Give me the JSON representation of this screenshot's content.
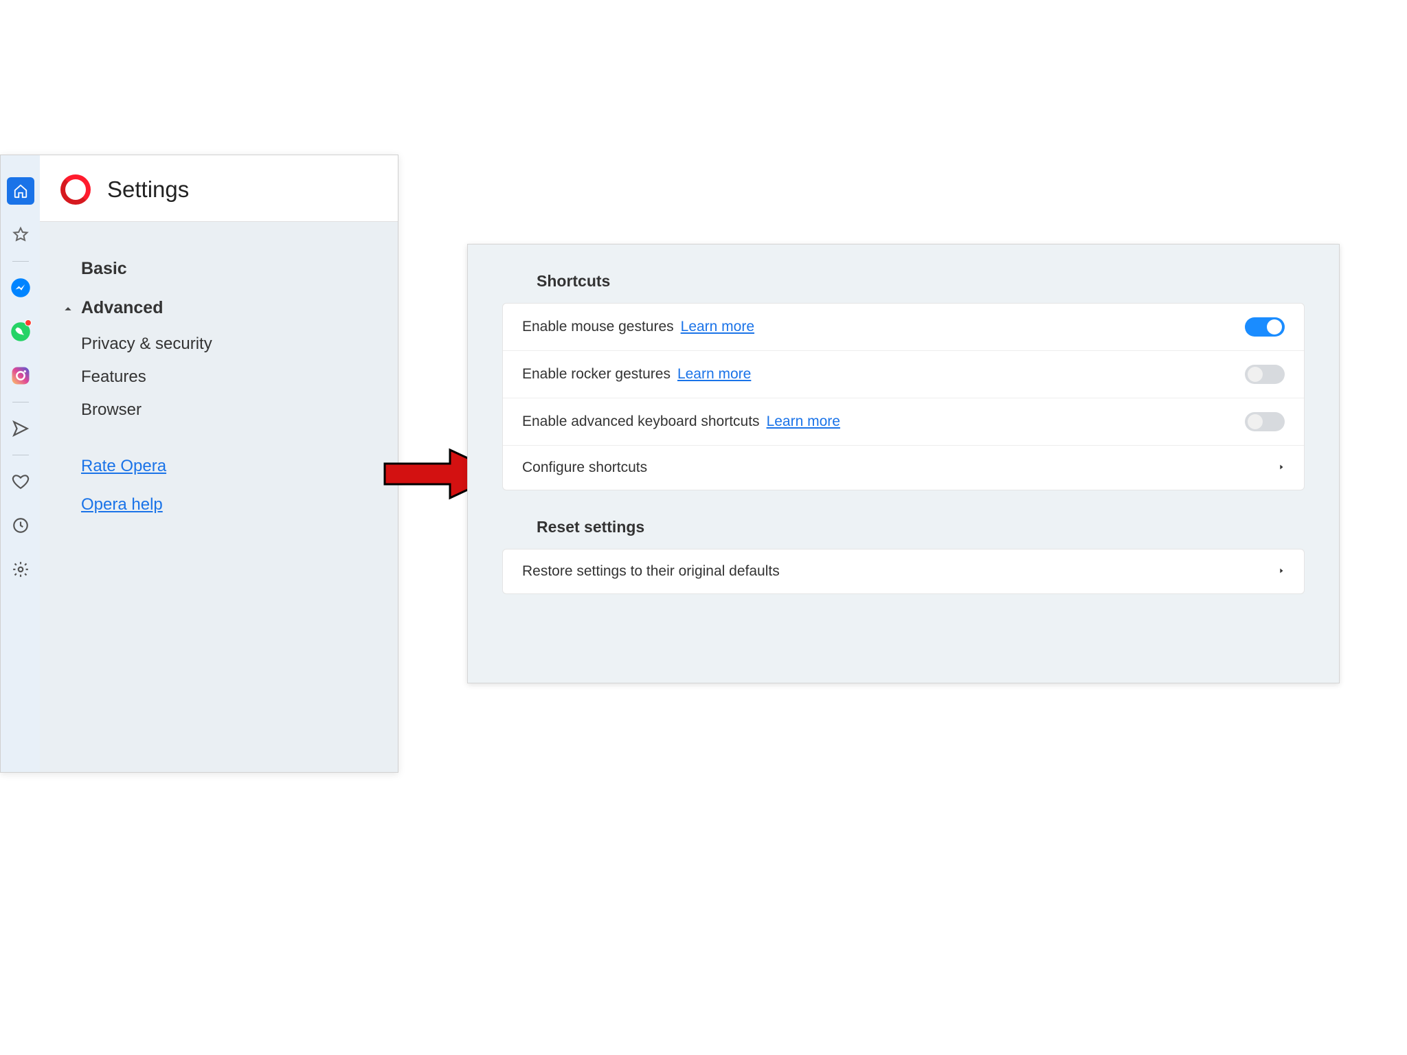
{
  "settings": {
    "title": "Settings",
    "nav": {
      "basic": "Basic",
      "advanced": "Advanced",
      "privacy": "Privacy & security",
      "features": "Features",
      "browser": "Browser",
      "rate": "Rate Opera",
      "help": "Opera help"
    }
  },
  "panel": {
    "shortcuts_title": "Shortcuts",
    "mouse_gestures": "Enable mouse gestures",
    "rocker_gestures": "Enable rocker gestures",
    "keyboard_shortcuts": "Enable advanced keyboard shortcuts",
    "learn_more": "Learn more",
    "configure": "Configure shortcuts",
    "reset_title": "Reset settings",
    "restore": "Restore settings to their original defaults",
    "toggles": {
      "mouse_gestures": true,
      "rocker_gestures": false,
      "keyboard_shortcuts": false
    }
  }
}
